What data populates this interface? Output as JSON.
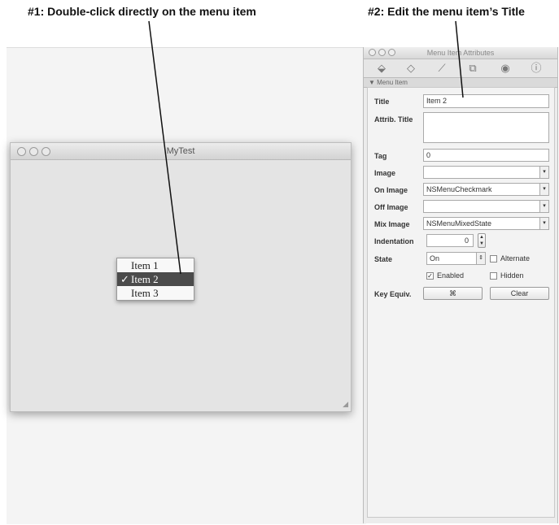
{
  "callouts": {
    "first": "#1: Double-click directly on the menu item",
    "second": "#2: Edit the menu item’s Title"
  },
  "window": {
    "title": "MyTest",
    "menu_items": [
      {
        "label": "Item 1",
        "selected": false
      },
      {
        "label": "Item 2",
        "selected": true
      },
      {
        "label": "Item 3",
        "selected": false
      }
    ],
    "check_glyph": "✓"
  },
  "inspector": {
    "title": "Menu Item Attributes",
    "section": "▼ Menu Item",
    "tabs": [
      "attributes-icon",
      "effects-icon",
      "size-icon",
      "bindings-icon",
      "connections-icon",
      "identity-icon"
    ],
    "fields": {
      "title_label": "Title",
      "title_value": "Item 2",
      "attrib_title_label": "Attrib. Title",
      "attrib_title_value": "",
      "tag_label": "Tag",
      "tag_value": "0",
      "image_label": "Image",
      "image_value": "",
      "on_image_label": "On Image",
      "on_image_value": "NSMenuCheckmark",
      "off_image_label": "Off Image",
      "off_image_value": "",
      "mix_image_label": "Mix Image",
      "mix_image_value": "NSMenuMixedState",
      "indentation_label": "Indentation",
      "indentation_value": "0",
      "state_label": "State",
      "state_value": "On",
      "alternate_label": "Alternate",
      "alternate_checked": false,
      "enabled_label": "Enabled",
      "enabled_checked": true,
      "hidden_label": "Hidden",
      "hidden_checked": false,
      "key_equiv_label": "Key Equiv.",
      "key_equiv_value": "⌘",
      "clear_label": "Clear"
    }
  }
}
